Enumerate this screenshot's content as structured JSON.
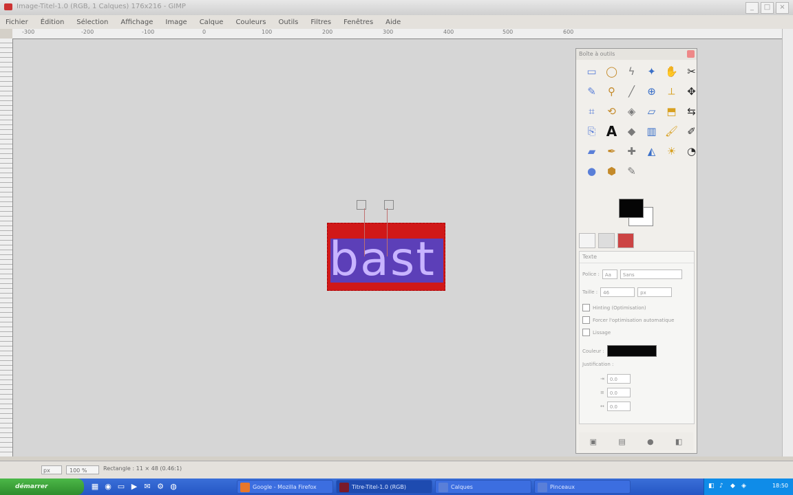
{
  "window": {
    "title": "Image-Titel-1.0 (RGB, 1 Calques) 176x216 - GIMP",
    "buttons": [
      "_",
      "□",
      "×"
    ]
  },
  "menubar": [
    "Fichier",
    "Édition",
    "Sélection",
    "Affichage",
    "Image",
    "Calque",
    "Couleurs",
    "Outils",
    "Filtres",
    "Fenêtres",
    "Aide"
  ],
  "ruler": {
    "ticks": [
      "-300",
      "-200",
      "-100",
      "0",
      "100",
      "200",
      "300",
      "400",
      "500",
      "600"
    ]
  },
  "canvas": {
    "text": "bast",
    "text_color": "#c8b4ff",
    "box_color": "#d01818",
    "highlight_color": "#5c3fb8"
  },
  "toolbox": {
    "title": "Boîte à outils",
    "tools": [
      {
        "name": "rect-select-icon",
        "glyph": "▭"
      },
      {
        "name": "ellipse-select-icon",
        "glyph": "◯"
      },
      {
        "name": "free-select-icon",
        "glyph": "ϟ"
      },
      {
        "name": "fuzzy-select-icon",
        "glyph": "✦"
      },
      {
        "name": "select-by-color-icon",
        "glyph": "✋"
      },
      {
        "name": "scissors-icon",
        "glyph": "✂"
      },
      {
        "name": "paths-icon",
        "glyph": "✎"
      },
      {
        "name": "color-picker-icon",
        "glyph": "⚲"
      },
      {
        "name": "pencil-icon",
        "glyph": "╱"
      },
      {
        "name": "zoom-icon",
        "glyph": "⊕"
      },
      {
        "name": "measure-icon",
        "glyph": "⟂"
      },
      {
        "name": "move-icon",
        "glyph": "✥"
      },
      {
        "name": "crop-icon",
        "glyph": "⌗"
      },
      {
        "name": "rotate-icon",
        "glyph": "⟲"
      },
      {
        "name": "scale-icon",
        "glyph": "◈"
      },
      {
        "name": "shear-icon",
        "glyph": "▱"
      },
      {
        "name": "perspective-icon",
        "glyph": "⬒"
      },
      {
        "name": "flip-icon",
        "glyph": "⇆"
      },
      {
        "name": "clone-icon",
        "glyph": "⎘"
      },
      {
        "name": "text-icon",
        "glyph": "A"
      },
      {
        "name": "bucket-fill-icon",
        "glyph": "◆"
      },
      {
        "name": "blend-icon",
        "glyph": "▥"
      },
      {
        "name": "paintbrush-icon",
        "glyph": "🖌"
      },
      {
        "name": "airbrush-icon",
        "glyph": "✐"
      },
      {
        "name": "eraser-icon",
        "glyph": "▰"
      },
      {
        "name": "ink-icon",
        "glyph": "✒"
      },
      {
        "name": "heal-icon",
        "glyph": "✚"
      },
      {
        "name": "convolve-icon",
        "glyph": "◭"
      },
      {
        "name": "smudge-icon",
        "glyph": "☀"
      },
      {
        "name": "dodge-burn-icon",
        "glyph": "◔"
      },
      {
        "name": "blur-icon",
        "glyph": "●"
      },
      {
        "name": "stamp-icon",
        "glyph": "⬢"
      },
      {
        "name": "picker-brush-icon",
        "glyph": "✎"
      }
    ],
    "options_title": "Texte",
    "font_label": "Police :",
    "font_value": "Sans",
    "size_label": "Taille :",
    "size_value": "46",
    "size_unit": "px",
    "hinting": "Hinting (Optimisation)",
    "force_hinting": "Forcer l'optimisation automatique",
    "antialias": "Lissage",
    "color_label": "Couleur :",
    "justify_label": "Justification :",
    "indent_value": "0.0",
    "line_spacing_value": "0.0",
    "letter_spacing_value": "0.0"
  },
  "status": {
    "unit": "px",
    "zoom": "100 %",
    "message": "Rectangle : 11 × 48 (0.46:1)"
  },
  "taskbar": {
    "start": "démarrer",
    "tasks": [
      {
        "label": "Google - Mozilla Firefox",
        "color": "#e8772a"
      },
      {
        "label": "Titre-Titel-1.0 (RGB)",
        "color": "#7a1a2a"
      },
      {
        "label": "Calques",
        "color": "#5a7fd8"
      },
      {
        "label": "Pinceaux",
        "color": "#5a7fd8"
      }
    ],
    "tray_time": "18:50"
  }
}
